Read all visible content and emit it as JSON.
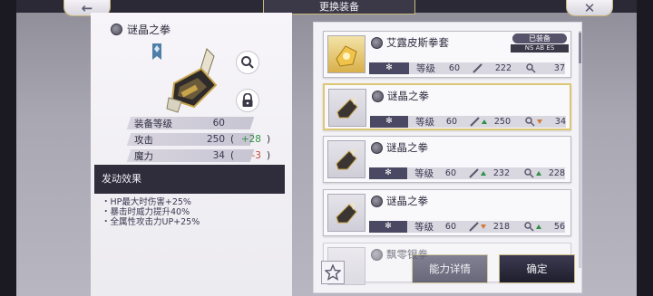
{
  "header": {
    "title": "更换装备",
    "back_icon": "←",
    "close_icon": "✕"
  },
  "detail": {
    "item_name": "谜晶之拳",
    "stats": [
      {
        "label": "装备等级",
        "value": "60",
        "paren_open": "",
        "delta": "",
        "paren_close": ""
      },
      {
        "label": "攻击",
        "value": "250",
        "paren_open": "(",
        "delta": "+28",
        "paren_close": ")"
      },
      {
        "label": "魔力",
        "value": "34",
        "paren_open": "(",
        "delta": "-3",
        "paren_close": ")"
      }
    ],
    "effect_title": "发动效果",
    "effects": [
      "・HP最大时伤害+25%",
      "・暴击时威力提升40%",
      "・全属性攻击力UP+25%"
    ]
  },
  "list": {
    "equipped_badge": "已装备",
    "equipped_sub": "NS AB ES",
    "element_glyph": "✻",
    "level_label": "等级",
    "items": [
      {
        "name": "艾露皮斯拳套",
        "level": "60",
        "atk": "222",
        "atk_trend": "",
        "mag": "37",
        "mag_trend": "",
        "equipped": true
      },
      {
        "name": "谜晶之拳",
        "level": "60",
        "atk": "250",
        "atk_trend": "up",
        "mag": "34",
        "mag_trend": "down",
        "selected": true
      },
      {
        "name": "谜晶之拳",
        "level": "60",
        "atk": "232",
        "atk_trend": "up",
        "mag": "228",
        "mag_trend": "up"
      },
      {
        "name": "谜晶之拳",
        "level": "60",
        "atk": "218",
        "atk_trend": "down",
        "mag": "56",
        "mag_trend": "up"
      },
      {
        "name": "飘零银拳"
      }
    ]
  },
  "buttons": {
    "detail": "能力详情",
    "confirm": "确定"
  },
  "colors": {
    "accent_gold": "#ddc775",
    "dark_panel": "#2f2d3c",
    "up": "#2f8f48",
    "down": "#c04a3a"
  }
}
